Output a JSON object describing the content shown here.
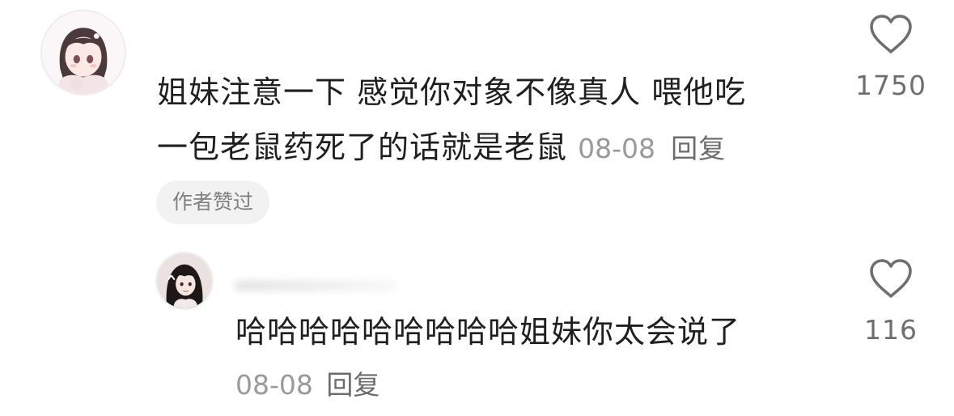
{
  "comment": {
    "text_line1": "姐妹注意一下 感觉你对象不像真人 喂他吃",
    "text_line2": "一包老鼠药死了的话就是老鼠",
    "date": "08-08",
    "reply_label": "回复",
    "badge": "作者赞过",
    "likes": "1750"
  },
  "reply": {
    "text": "哈哈哈哈哈哈哈哈哈姐妹你太会说了",
    "date": "08-08",
    "reply_label": "回复",
    "likes": "116"
  },
  "colors": {
    "text": "#1f1f1f",
    "meta": "#9a9a9a",
    "reply_link": "#6b6b6b",
    "badge_bg": "#f2f2f2",
    "icon": "#6f6f6f"
  }
}
